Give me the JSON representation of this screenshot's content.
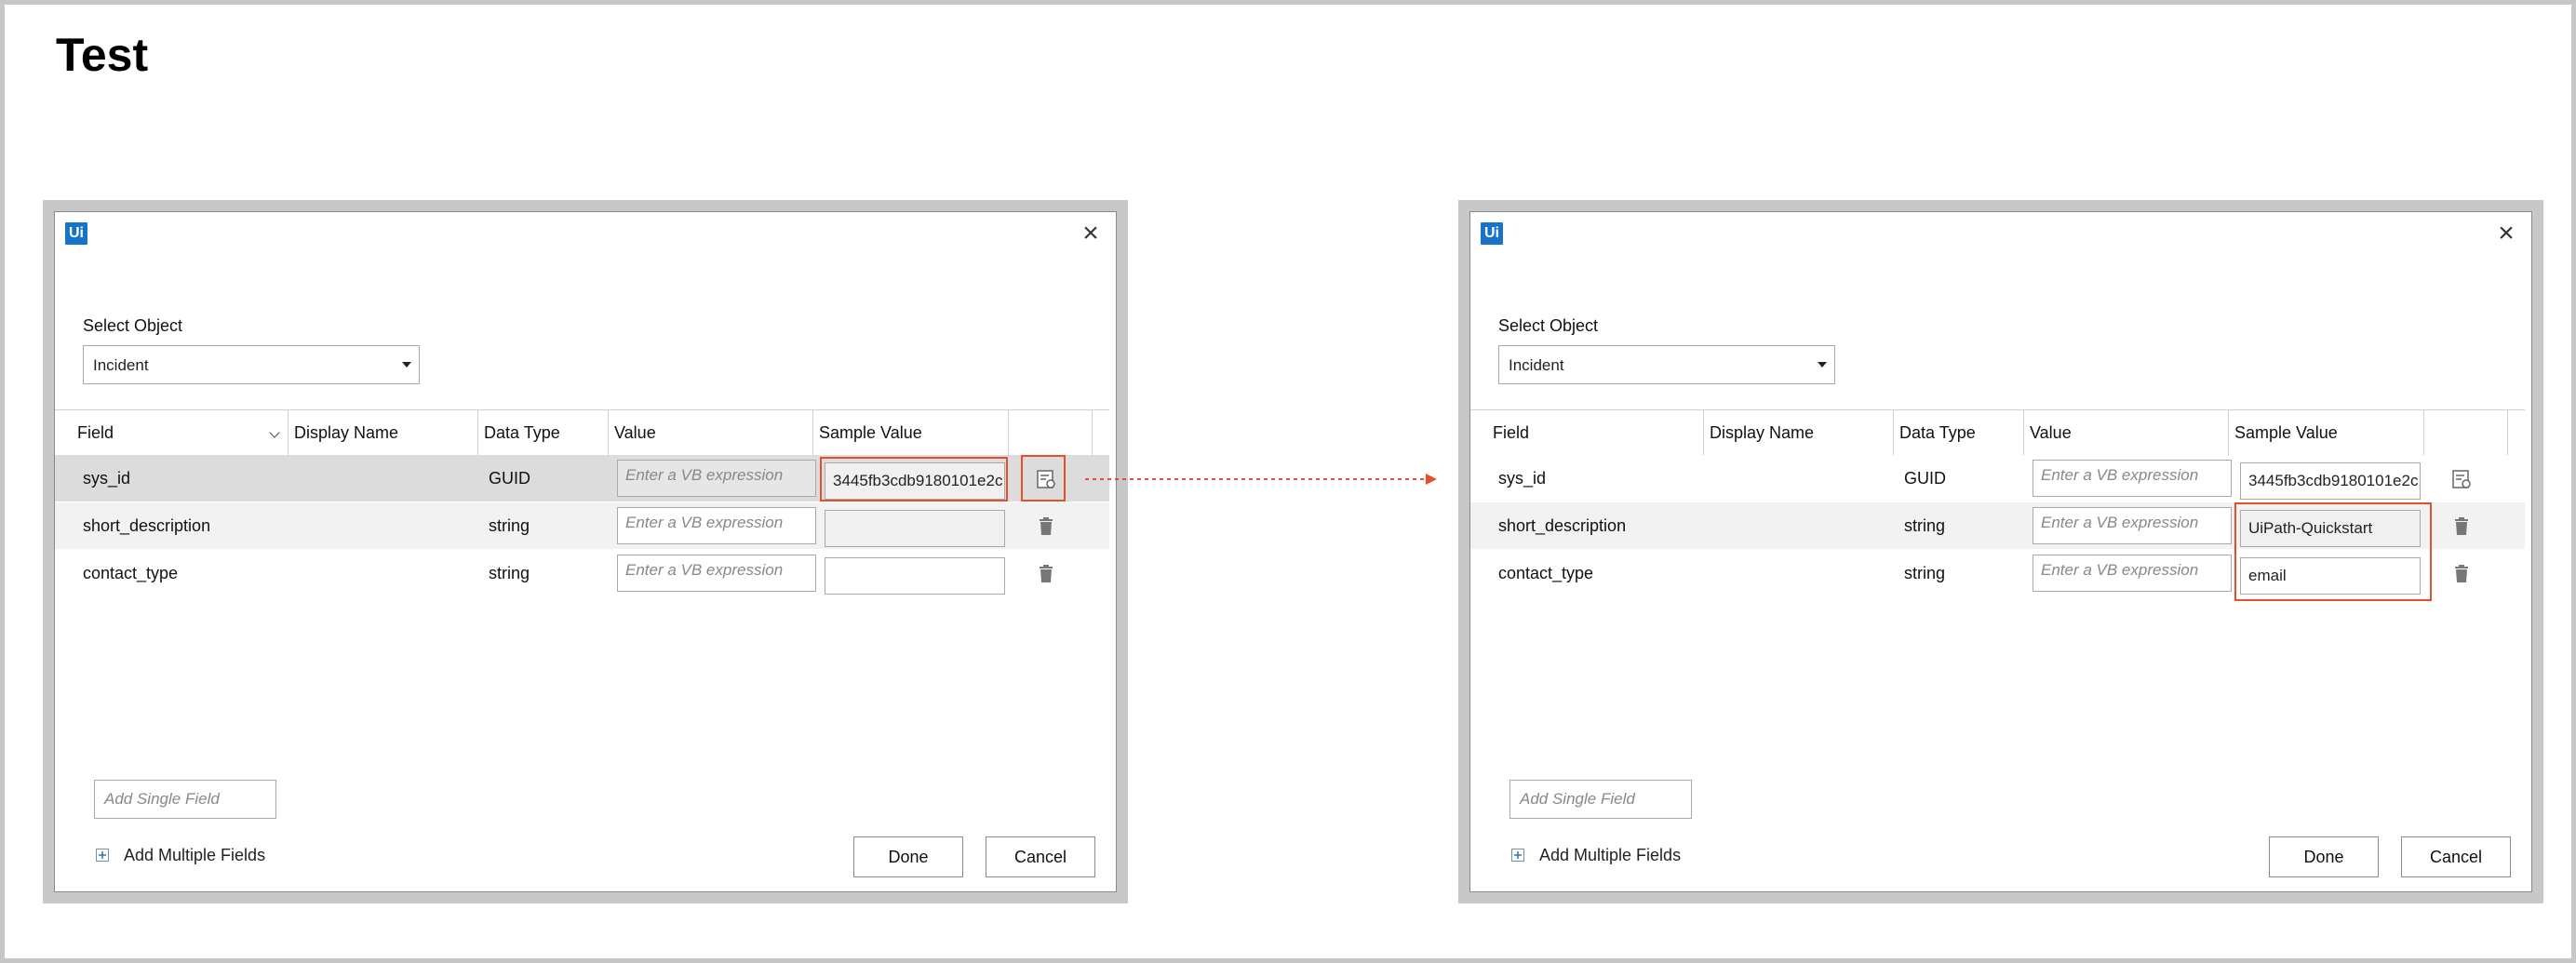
{
  "page": {
    "title": "Test"
  },
  "colors": {
    "highlight": "#e2502c",
    "logo": "#1673c9"
  },
  "dialog_left": {
    "logo": "Ui",
    "close_symbol": "×",
    "select_label": "Select Object",
    "select_value": "Incident",
    "columns": [
      "Field",
      "Display Name",
      "Data Type",
      "Value",
      "Sample Value"
    ],
    "rows": [
      {
        "field": "sys_id",
        "display_name": "",
        "data_type": "GUID",
        "value_placeholder": "Enter a VB expression",
        "sample": "3445fb3cdb9180101e2c",
        "action_icon": "schema-icon"
      },
      {
        "field": "short_description",
        "display_name": "",
        "data_type": "string",
        "value_placeholder": "Enter a VB expression",
        "sample": "",
        "action_icon": "trash-icon"
      },
      {
        "field": "contact_type",
        "display_name": "",
        "data_type": "string",
        "value_placeholder": "Enter a VB expression",
        "sample": "",
        "action_icon": "trash-icon"
      }
    ],
    "add_single_placeholder": "Add Single Field",
    "add_multiple_label": "Add Multiple Fields",
    "done_label": "Done",
    "cancel_label": "Cancel"
  },
  "dialog_right": {
    "logo": "Ui",
    "close_symbol": "×",
    "select_label": "Select Object",
    "select_value": "Incident",
    "columns": [
      "Field",
      "Display Name",
      "Data Type",
      "Value",
      "Sample Value"
    ],
    "rows": [
      {
        "field": "sys_id",
        "display_name": "",
        "data_type": "GUID",
        "value_placeholder": "Enter a VB expression",
        "sample": "3445fb3cdb9180101e2c",
        "action_icon": "schema-icon"
      },
      {
        "field": "short_description",
        "display_name": "",
        "data_type": "string",
        "value_placeholder": "Enter a VB expression",
        "sample": "UiPath-Quickstart",
        "action_icon": "trash-icon"
      },
      {
        "field": "contact_type",
        "display_name": "",
        "data_type": "string",
        "value_placeholder": "Enter a VB expression",
        "sample": "email",
        "action_icon": "trash-icon"
      }
    ],
    "add_single_placeholder": "Add Single Field",
    "add_multiple_label": "Add Multiple Fields",
    "done_label": "Done",
    "cancel_label": "Cancel"
  }
}
